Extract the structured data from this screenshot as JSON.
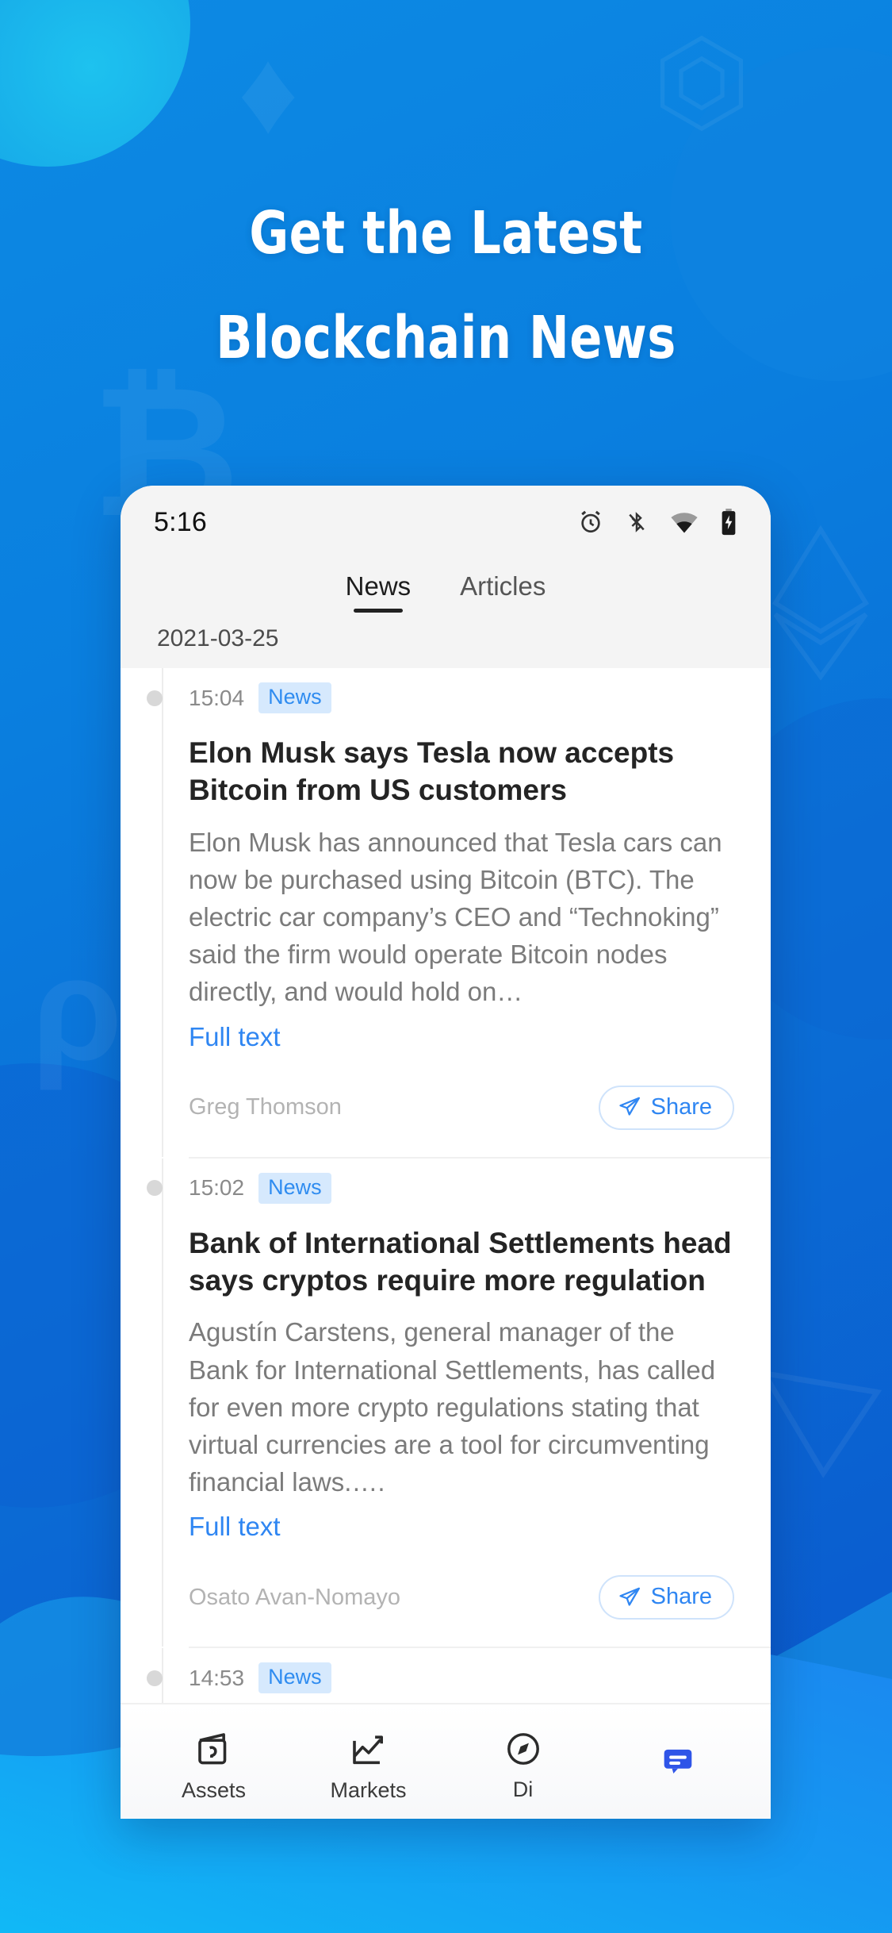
{
  "promo": {
    "headline_line1": "Get the Latest",
    "headline_line2": "Blockchain News",
    "accent_color": "#0d8ae4",
    "wave_color": "#12bdf5"
  },
  "statusbar": {
    "time": "5:16",
    "icons": [
      "alarm-icon",
      "bluetooth-disabled-icon",
      "wifi-icon",
      "battery-charging-icon"
    ]
  },
  "tabs": [
    {
      "label": "News",
      "active": true
    },
    {
      "label": "Articles",
      "active": false
    }
  ],
  "feed": {
    "date": "2021-03-25",
    "badge_color": "#2f8cf0",
    "items": [
      {
        "time": "15:04",
        "badge": "News",
        "title": "Elon Musk says Tesla now accepts Bitcoin from US customers",
        "summary": "Elon Musk has announced that Tesla cars can now be purchased using Bitcoin (BTC). The electric car company’s CEO and “Technoking” said the firm would operate Bitcoin nodes directly, and would hold on…",
        "full_text_label": "Full text",
        "author": "Greg Thomson",
        "share_label": "Share"
      },
      {
        "time": "15:02",
        "badge": "News",
        "title": "Bank of International Settlements head says cryptos require more regulation",
        "summary": "Agustín Carstens, general manager of the Bank for International Settlements, has called for even more crypto regulations stating that virtual currencies are a tool for circumventing financial laws.….",
        "full_text_label": "Full text",
        "author": "Osato Avan-Nomayo",
        "share_label": "Share"
      },
      {
        "time": "14:53",
        "badge": "News",
        "title": "",
        "summary": "",
        "full_text_label": "",
        "author": "",
        "share_label": ""
      }
    ]
  },
  "bottomnav": {
    "items": [
      {
        "label": "Assets",
        "icon": "wallet-icon",
        "active": false
      },
      {
        "label": "Markets",
        "icon": "chart-icon",
        "active": false
      },
      {
        "label": "Di",
        "icon": "compass-icon",
        "active": false
      },
      {
        "label": "",
        "icon": "news-icon",
        "active": true
      }
    ]
  }
}
